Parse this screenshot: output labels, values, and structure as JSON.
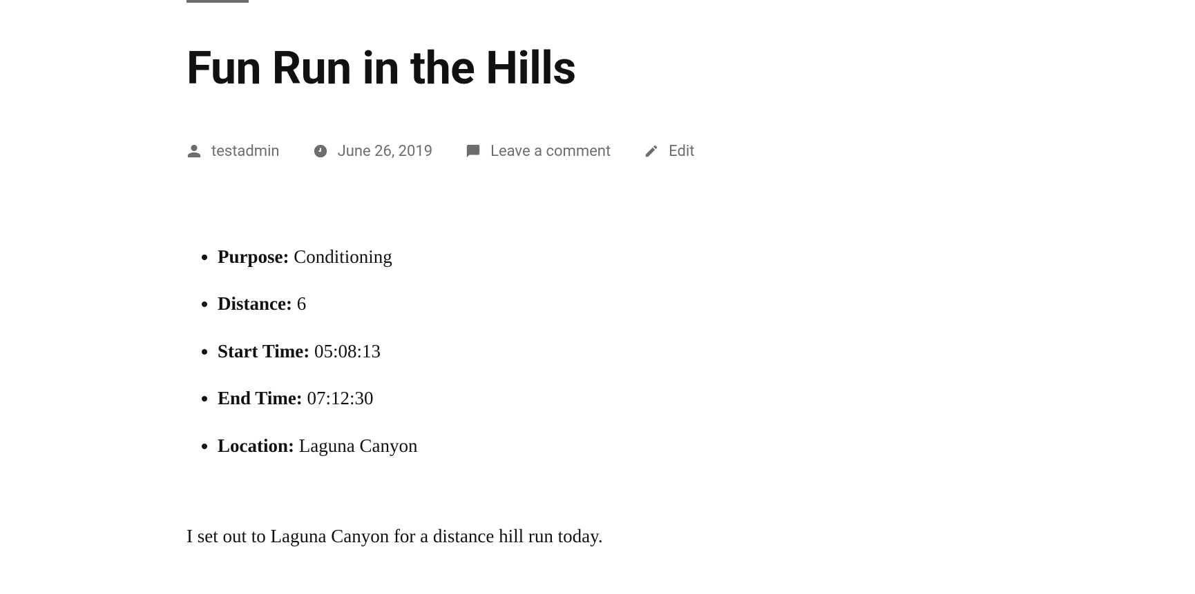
{
  "post": {
    "title": "Fun Run in the Hills"
  },
  "meta": {
    "author": "testadmin",
    "date": "June 26, 2019",
    "comment_link": "Leave a comment",
    "edit_link": "Edit"
  },
  "details": {
    "items": [
      {
        "label": "Purpose:",
        "value": "Conditioning"
      },
      {
        "label": "Distance:",
        "value": "6"
      },
      {
        "label": "Start Time:",
        "value": "05:08:13"
      },
      {
        "label": "End Time:",
        "value": "07:12:30"
      },
      {
        "label": "Location:",
        "value": "Laguna Canyon"
      }
    ]
  },
  "body": {
    "paragraph1": "I set out to Laguna Canyon for a distance hill run today."
  }
}
